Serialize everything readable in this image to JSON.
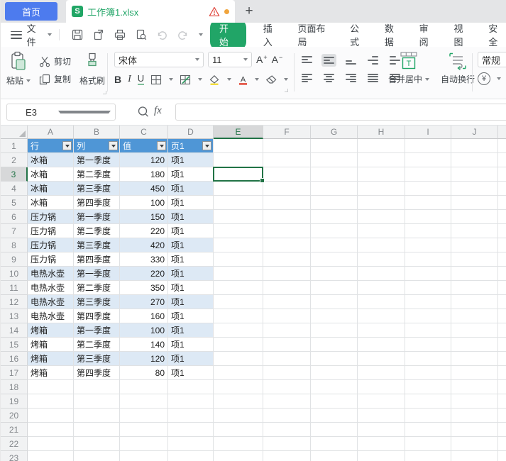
{
  "tab_bar": {
    "home": "首页",
    "doc_title": "工作簿1.xlsx",
    "new_tab": "+"
  },
  "menu_bar": {
    "file_label": "文件",
    "tabs": [
      "开始",
      "插入",
      "页面布局",
      "公式",
      "数据",
      "审阅",
      "视图",
      "安全"
    ],
    "active_tab": "开始"
  },
  "ribbon": {
    "paste": "粘贴",
    "cut": "剪切",
    "copy": "复制",
    "format_painter": "格式刷",
    "font_name": "宋体",
    "font_size": "11",
    "bold": "B",
    "italic": "I",
    "underline": "U",
    "font_bigger": "A",
    "font_smaller": "A",
    "merge_center": "合并居中",
    "wrap_text": "自动换行",
    "number_format": "常规",
    "currency_symbol": "¥"
  },
  "formula_bar": {
    "name_box": "E3",
    "fx_label": "fx",
    "formula_value": ""
  },
  "sheet": {
    "column_letters": [
      "A",
      "B",
      "C",
      "D",
      "E",
      "F",
      "G",
      "H",
      "I",
      "J"
    ],
    "row_count": 23,
    "active_cell": {
      "ref": "E3",
      "column": "E",
      "row": 3
    },
    "pivot_table": {
      "header_row": [
        "行",
        "列",
        "值",
        "页1"
      ],
      "rows": [
        [
          "冰箱",
          "第一季度",
          "120",
          "项1"
        ],
        [
          "冰箱",
          "第二季度",
          "180",
          "项1"
        ],
        [
          "冰箱",
          "第三季度",
          "450",
          "项1"
        ],
        [
          "冰箱",
          "第四季度",
          "100",
          "项1"
        ],
        [
          "压力锅",
          "第一季度",
          "150",
          "项1"
        ],
        [
          "压力锅",
          "第二季度",
          "220",
          "项1"
        ],
        [
          "压力锅",
          "第三季度",
          "420",
          "项1"
        ],
        [
          "压力锅",
          "第四季度",
          "330",
          "项1"
        ],
        [
          "电热水壶",
          "第一季度",
          "220",
          "项1"
        ],
        [
          "电热水壶",
          "第二季度",
          "350",
          "项1"
        ],
        [
          "电热水壶",
          "第三季度",
          "270",
          "项1"
        ],
        [
          "电热水壶",
          "第四季度",
          "160",
          "项1"
        ],
        [
          "烤箱",
          "第一季度",
          "100",
          "项1"
        ],
        [
          "烤箱",
          "第二季度",
          "140",
          "项1"
        ],
        [
          "烤箱",
          "第三季度",
          "120",
          "项1"
        ],
        [
          "烤箱",
          "第四季度",
          "80",
          "项1"
        ]
      ]
    }
  },
  "colors": {
    "home_tab_blue": "#4d7bee",
    "brand_green": "#21a567",
    "selection_green": "#217346",
    "pivot_header_blue": "#4f96d6",
    "band_blue": "#dde9f5",
    "warning_red": "#e0443a",
    "unsaved_dot_orange": "#f0a43c"
  }
}
